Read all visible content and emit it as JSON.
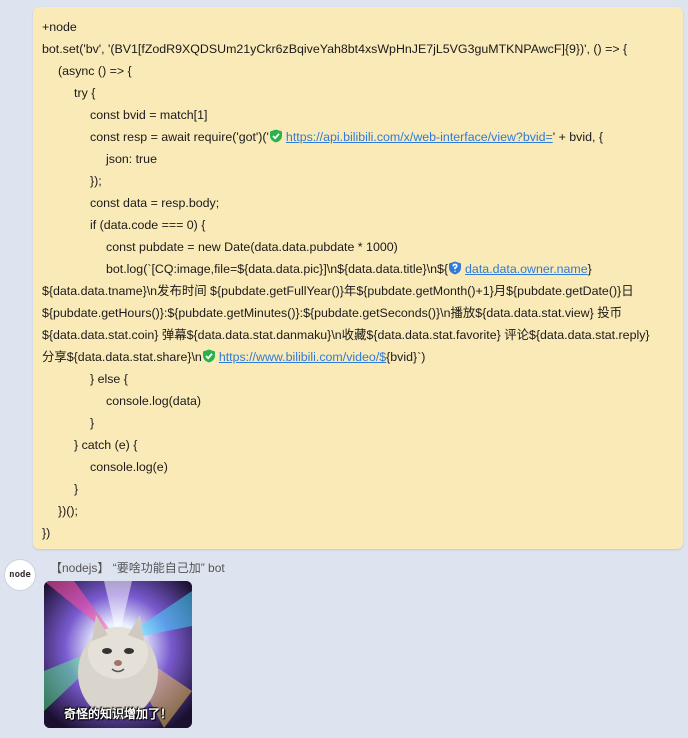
{
  "message": {
    "code_lines": [
      {
        "indent": 0,
        "text": "+node"
      },
      {
        "indent": 0,
        "text": "bot.set('bv', '(BV1[fZodR9XQDSUm21yCkr6zBqiveYah8bt4xsWpHnJE7jL5VG3guMTKNPAwcF]{9})', () => {"
      },
      {
        "indent": 1,
        "text": "(async () => {"
      },
      {
        "indent": 2,
        "text": "try {"
      },
      {
        "indent": 3,
        "text": "const bvid = match[1]"
      },
      {
        "indent": 3,
        "text_before": "const resp = await require('got')('",
        "link": "https://api.bilibili.com/x/web-interface/view?bvid=",
        "link_icon": "verified-shield-icon",
        "text_after": "' + bvid, {"
      },
      {
        "indent": 4,
        "text": "json: true"
      },
      {
        "indent": 3,
        "text": "});"
      },
      {
        "indent": 3,
        "text": "const data = resp.body;"
      },
      {
        "indent": 3,
        "text": "if (data.code === 0) {"
      },
      {
        "indent": 4,
        "text": "const pubdate = new Date(data.data.pubdate * 1000)"
      },
      {
        "indent": 4,
        "text_before": "bot.log(`[CQ:image,file=${data.data.pic}]\\n${data.data.title}\\n${",
        "link": "data.data.owner.name",
        "link_icon": "unknown-shield-icon",
        "text_after": "}"
      },
      {
        "indent": 0,
        "text": "${data.data.tname}\\n发布时间 ${pubdate.getFullYear()}年${pubdate.getMonth()+1}月${pubdate.getDate()}日"
      },
      {
        "indent": 0,
        "text": "${pubdate.getHours()}:${pubdate.getMinutes()}:${pubdate.getSeconds()}\\n播放${data.data.stat.view} 投币"
      },
      {
        "indent": 0,
        "text": "${data.data.stat.coin} 弹幕${data.data.stat.danmaku}\\n收藏${data.data.stat.favorite} 评论${data.data.stat.reply}"
      },
      {
        "indent": 0,
        "text_before": "分享${data.data.stat.share}\\n",
        "link": "https://www.bilibili.com/video/$",
        "link_icon": "verified-shield-icon",
        "text_after": "{bvid}`)"
      },
      {
        "indent": 3,
        "text": "} else {"
      },
      {
        "indent": 4,
        "text": "console.log(data)"
      },
      {
        "indent": 3,
        "text": "}"
      },
      {
        "indent": 2,
        "text": "} catch (e) {"
      },
      {
        "indent": 3,
        "text": "console.log(e)"
      },
      {
        "indent": 2,
        "text": "}"
      },
      {
        "indent": 1,
        "text": "})();"
      },
      {
        "indent": 0,
        "text": "})"
      }
    ]
  },
  "reply": {
    "avatar_text": "node",
    "sender": "【nodejs】 “要啥功能自己加” bot",
    "sticker_caption": "奇怪的知识增加了！"
  },
  "colors": {
    "bubble": "#faeab8",
    "background": "#dde3ef",
    "link": "#2f7bd6",
    "shield_green": "#2bb24c",
    "shield_blue": "#2f7bd6"
  }
}
